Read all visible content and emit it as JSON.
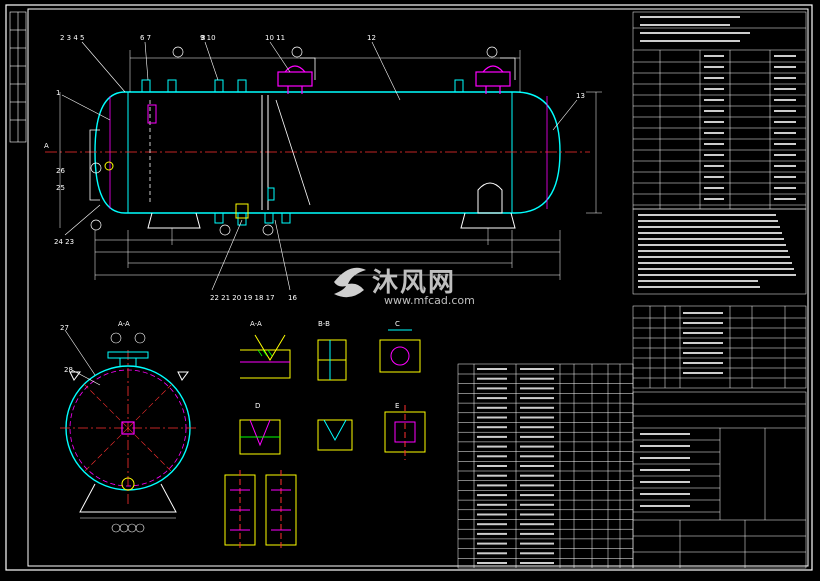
{
  "watermark": {
    "cn": "沐风网",
    "url": "www.mfcad.com"
  },
  "elevation": {
    "balloons_top": [
      "2 3 4 5",
      "6 7",
      "8",
      "9 10",
      "10 11",
      "12"
    ],
    "balloons_left": [
      "1",
      "26",
      "25",
      "24 23"
    ],
    "balloons_right": [
      "13"
    ],
    "balloons_bottom": [
      "22 21 20 19 18 17",
      "16"
    ],
    "nozzle_tags": [
      "⑭",
      "⑬",
      "⑫",
      "⑪",
      "⑩",
      "⑨"
    ],
    "section_marker": "A"
  },
  "side_view": {
    "balloons": [
      "27",
      "28",
      "A-A"
    ],
    "nozzle_tags": [
      "a",
      "b",
      "c",
      "d",
      "e",
      "f"
    ]
  },
  "details": [
    "A-A",
    "B-B",
    "C",
    "D",
    "E"
  ],
  "colors": {
    "shell": "#00ffff",
    "dim": "#ffffff",
    "center": "#ff3030",
    "accent": "#ff00ff",
    "nozzle": "#ffff00",
    "hatch": "#00ff00"
  }
}
